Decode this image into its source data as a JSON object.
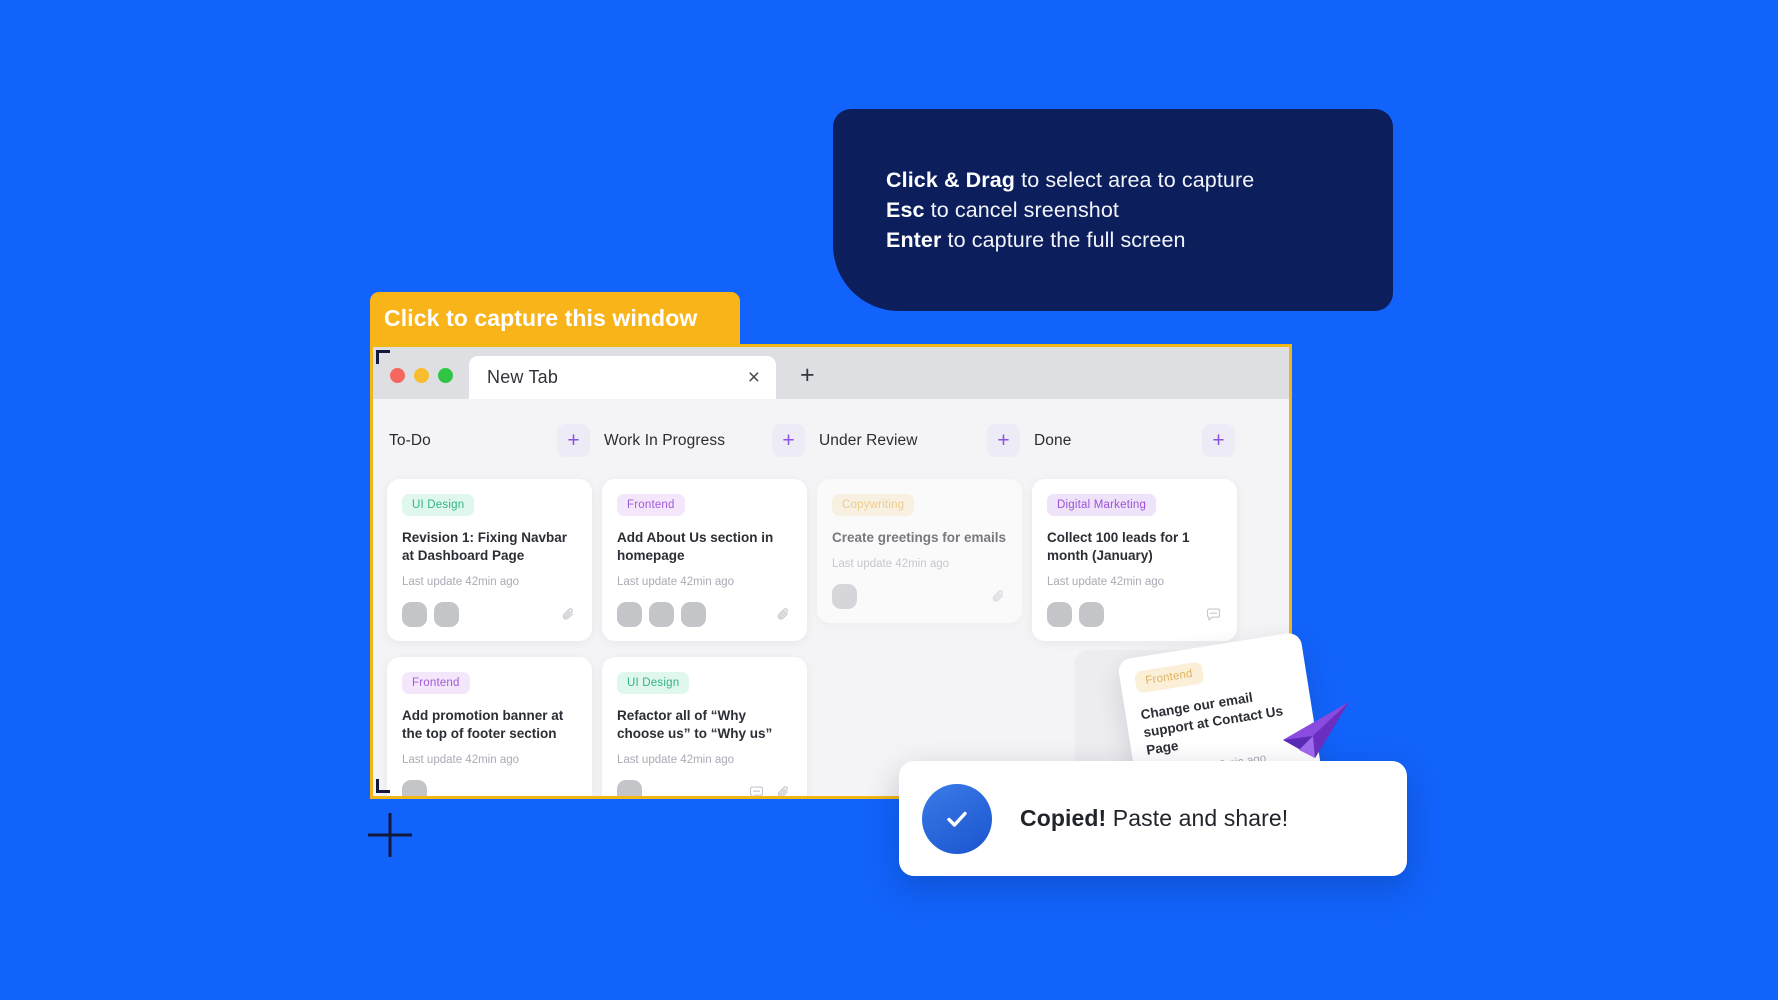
{
  "tooltip": {
    "lines": [
      {
        "key": "Click & Drag",
        "rest": " to select area to capture"
      },
      {
        "key": "Esc",
        "rest": " to cancel sreenshot"
      },
      {
        "key": "Enter",
        "rest": " to capture the full screen"
      }
    ]
  },
  "capture_banner": {
    "label": "Click to capture this window"
  },
  "browser": {
    "tab_title": "New Tab",
    "close_icon": "×",
    "new_tab_icon": "+"
  },
  "board": {
    "add_icon": "+",
    "columns": [
      {
        "title": "To-Do",
        "cards": [
          {
            "tag": "UI Design",
            "tag_style": "uidesign",
            "title": "Revision 1: Fixing Navbar at Dashboard Page",
            "meta": "Last update 42min ago",
            "avatars": 2,
            "icons": [
              "attachment-icon"
            ]
          },
          {
            "tag": "Frontend",
            "tag_style": "frontend",
            "title": "Add promotion banner at the top of footer section",
            "meta": "Last update 42min ago",
            "avatars": 1,
            "icons": []
          }
        ]
      },
      {
        "title": "Work In Progress",
        "cards": [
          {
            "tag": "Frontend",
            "tag_style": "frontend",
            "title": "Add About Us section in homepage",
            "meta": "Last update 42min ago",
            "avatars": 3,
            "icons": [
              "attachment-icon"
            ]
          },
          {
            "tag": "UI Design",
            "tag_style": "uidesign",
            "title": "Refactor all of “Why choose us” to “Why us”",
            "meta": "Last update 42min ago",
            "avatars": 1,
            "icons": [
              "comment-icon",
              "attachment-icon"
            ]
          }
        ]
      },
      {
        "title": "Under Review",
        "cards": [
          {
            "tag": "Copywriting",
            "tag_style": "copy",
            "title": "Create greetings for emails",
            "meta": "Last update 42min ago",
            "avatars": 1,
            "icons": [
              "attachment-icon"
            ]
          }
        ]
      },
      {
        "title": "Done",
        "cards": [
          {
            "tag": "Digital Marketing",
            "tag_style": "marketing",
            "title": "Collect 100 leads for 1 month (January)",
            "meta": "Last update 42min ago",
            "avatars": 2,
            "icons": [
              "comment-icon"
            ]
          }
        ]
      }
    ]
  },
  "drag_card": {
    "tag": "Frontend",
    "title": "Change our email support at Contact Us Page",
    "meta": "Last update 42min ago"
  },
  "toast": {
    "bold": "Copied!",
    "rest": " Paste and share!",
    "icon": "check-icon"
  },
  "colors": {
    "background": "#1263FB",
    "tooltip": "#0C1F5C",
    "banner": "#F9B41A",
    "selection_border": "#F2B617",
    "accent_purple": "#8D52E3",
    "toast_blue": "#1A54CE"
  }
}
